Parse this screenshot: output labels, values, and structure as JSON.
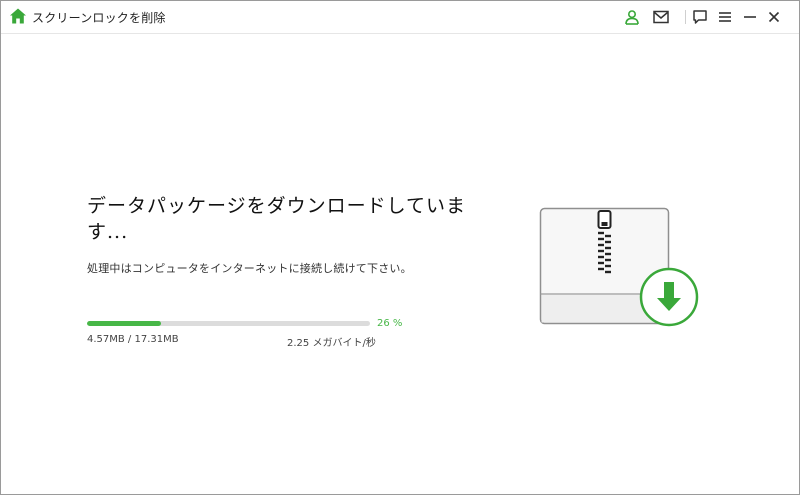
{
  "window": {
    "title": "スクリーンロックを削除",
    "icons": [
      "home-icon",
      "account-icon",
      "mail-icon",
      "feedback-icon",
      "menu-icon",
      "minimize-icon",
      "close-icon"
    ]
  },
  "main": {
    "heading": "データパッケージをダウンロードしています...",
    "subtext": "処理中はコンピュータをインターネットに接続し続けて下さい。"
  },
  "progress": {
    "fraction": 0.26,
    "percent_label": "26 %",
    "size_label": "4.57MB / 17.31MB",
    "speed_label": "2.25 メガバイト/秒"
  },
  "colors": {
    "accent_green": "#47b747",
    "track_gray": "#dcdcdc",
    "text_dark": "#222222"
  },
  "illustration": {
    "icons": [
      "zip-archive-icon",
      "download-arrow-icon"
    ]
  }
}
